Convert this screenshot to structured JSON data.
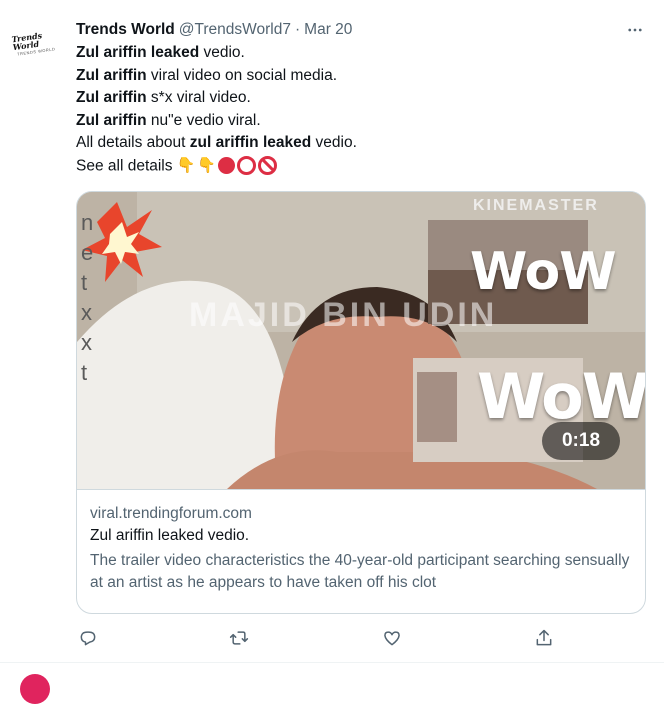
{
  "tweet": {
    "author_name": "Trends World",
    "author_handle": "@TrendsWorld7",
    "separator": "·",
    "date": "Mar 20",
    "avatar_text": "Trends World",
    "avatar_subtext": "TRENDS WORLD",
    "lines": [
      {
        "bold": "Zul ariffin leaked",
        "rest": " vedio."
      },
      {
        "bold": "Zul ariffin",
        "rest": " viral video on social media."
      },
      {
        "bold": "Zul ariffin",
        "rest": " s*x viral video."
      },
      {
        "bold": "Zul ariffin",
        "rest": " nu\"e vedio viral."
      }
    ],
    "line5_pre": "All details about ",
    "line5_bold": "zul ariffin leaked",
    "line5_post": " vedio.",
    "line6": "See all details"
  },
  "media": {
    "side_letters": [
      "n",
      "e",
      "t",
      "x",
      "x",
      "t"
    ],
    "brand_watermark": "KINEMASTER",
    "center_watermark": "MAJID BIN UDIN",
    "overlay_1": "WoW",
    "overlay_2": "WoW",
    "duration": "0:18"
  },
  "card": {
    "domain": "viral.trendingforum.com",
    "title": "Zul ariffin leaked vedio.",
    "description": "The trailer video characteristics the 40-year-old participant searching sensually at an artist as he appears to have taken off his clot"
  },
  "icons": {
    "reply": "reply-icon",
    "retweet": "retweet-icon",
    "like": "like-icon",
    "share": "share-icon",
    "more": "more-icon"
  },
  "colors": {
    "text": "#0f1419",
    "secondary": "#536471",
    "border": "#cfd9de",
    "emoji_red": "#dd2e44"
  }
}
